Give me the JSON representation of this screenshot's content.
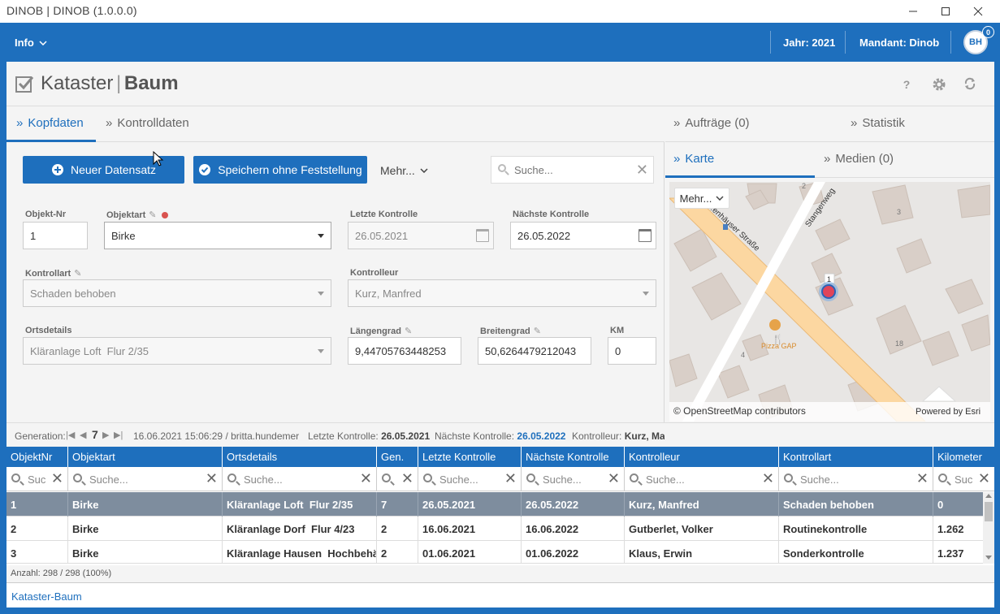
{
  "window": {
    "title": "DINOB | DINOB (1.0.0.0)"
  },
  "nav": {
    "info_label": "Info",
    "year_label": "Jahr: 2021",
    "client_label": "Mandant: Dinob",
    "avatar_initials": "BH",
    "notification_count": "0"
  },
  "header": {
    "title_light": "Kataster",
    "title_bold": "Baum"
  },
  "left_tabs": [
    "Kopfdaten",
    "Kontrolldaten"
  ],
  "toolbar": {
    "new_label": "Neuer Datensatz",
    "save_label": "Speichern ohne Feststellung",
    "more_label": "Mehr...",
    "search_placeholder": "Suche..."
  },
  "form": {
    "objekt_nr": {
      "label": "Objekt-Nr",
      "value": "1"
    },
    "objektart": {
      "label": "Objektart",
      "value": "Birke"
    },
    "letzte_kontrolle": {
      "label": "Letzte Kontrolle",
      "value": "26.05.2021"
    },
    "naechste_kontrolle": {
      "label": "Nächste Kontrolle",
      "value": "26.05.2022"
    },
    "kontrollart": {
      "label": "Kontrollart",
      "value": "Schaden behoben"
    },
    "kontrolleur": {
      "label": "Kontrolleur",
      "value": "Kurz, Manfred"
    },
    "ortsdetails": {
      "label": "Ortsdetails",
      "value": "Kläranlage Loft  Flur 2/35"
    },
    "laengengrad": {
      "label": "Längengrad",
      "value": "9,44705763448253"
    },
    "breitengrad": {
      "label": "Breitengrad",
      "value": "50,6264479212043"
    },
    "km": {
      "label": "KM",
      "value": "0"
    }
  },
  "right_tabs": {
    "auftraege": "Aufträge (0)",
    "statistik": "Statistik",
    "karte": "Karte",
    "medien": "Medien (0)"
  },
  "map": {
    "more_label": "Mehr...",
    "street1": "Stangenweg",
    "street2": "...enhäuser Straße",
    "poi_label": "Pizza GAP",
    "house_numbers": [
      "2",
      "3",
      "4",
      "18",
      "1"
    ],
    "attribution_left": "© OpenStreetMap contributors",
    "attribution_right": "Powered by Esri",
    "marker_color": "#e0455a",
    "road_color": "#fcd7a1"
  },
  "genbar": {
    "prefix": "Generation:",
    "generation": "7",
    "timestamp": "16.06.2021 15:06:29 / britta.hundemer",
    "lk_label": "Letzte Kontrolle:",
    "lk_value": "26.05.2021",
    "nk_label": "Nächste Kontrolle:",
    "nk_value": "26.05.2022",
    "ko_label": "Kontrolleur:",
    "ko_value": "Kurz, Mar"
  },
  "grid": {
    "columns": [
      "ObjektNr",
      "Objektart",
      "Ortsdetails",
      "Gen.",
      "Letzte Kontrolle",
      "Nächste Kontrolle",
      "Kontrolleur",
      "Kontrollart",
      "Kilometer"
    ],
    "filters": [
      "Suc",
      "Suche...",
      "Suche...",
      "",
      "Suche...",
      "Suche...",
      "Suche...",
      "Suche...",
      "Suc"
    ],
    "rows": [
      [
        "1",
        "Birke",
        "Kläranlage Loft  Flur 2/35",
        "7",
        "26.05.2021",
        "26.05.2022",
        "Kurz, Manfred",
        "Schaden behoben",
        "0"
      ],
      [
        "2",
        "Birke",
        "Kläranlage Dorf  Flur 4/23",
        "2",
        "16.06.2021",
        "16.06.2022",
        "Gutberlet, Volker",
        "Routinekontrolle",
        "1.262"
      ],
      [
        "3",
        "Birke",
        "Kläranlage Hausen  Hochbehälter",
        "2",
        "01.06.2021",
        "01.06.2022",
        "Klaus, Erwin",
        "Sonderkontrolle",
        "1.237"
      ]
    ],
    "count_label": "Anzahl: 298 / 298 (100%)"
  },
  "footer": {
    "tab_label": "Kataster-Baum"
  },
  "colors": {
    "primary": "#1e6fbd",
    "selected_row": "#7e8d9e"
  }
}
